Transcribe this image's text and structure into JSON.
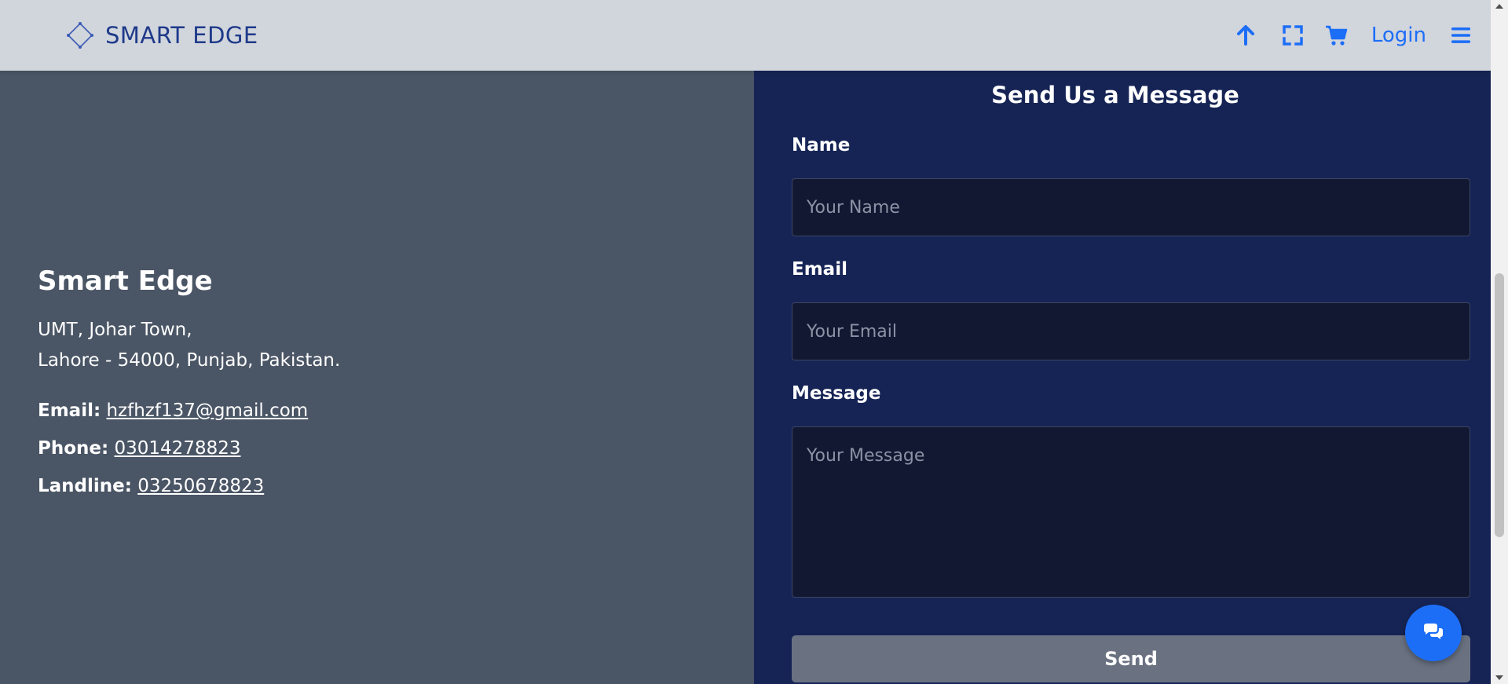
{
  "header": {
    "brand_name": "SMART EDGE",
    "logo_icon": "diamond-logo-icon",
    "actions": {
      "scroll_top_icon": "arrow-up-icon",
      "fullscreen_icon": "fullscreen-icon",
      "cart_icon": "cart-icon",
      "login_label": "Login",
      "menu_icon": "hamburger-menu-icon"
    }
  },
  "contact_info": {
    "company_name": "Smart Edge",
    "address_line1": "UMT, Johar Town,",
    "address_line2": "Lahore - 54000, Punjab, Pakistan.",
    "email_label": "Email:",
    "email_value": "hzfhzf137@gmail.com",
    "phone_label": "Phone:",
    "phone_value": "03014278823",
    "landline_label": "Landline:",
    "landline_value": "03250678823"
  },
  "form": {
    "title": "Send Us a Message",
    "name_label": "Name",
    "name_placeholder": "Your Name",
    "email_label": "Email",
    "email_placeholder": "Your Email",
    "message_label": "Message",
    "message_placeholder": "Your Message",
    "send_label": "Send"
  },
  "chat": {
    "icon": "chat-bubbles-icon"
  },
  "colors": {
    "navbar_bg": "#d1d5dc",
    "accent": "#1d6ef7",
    "brand_text": "#1e3a8a",
    "left_panel_bg": "#4a5565",
    "right_panel_bg": "#162455",
    "input_bg": "#121831",
    "send_button_bg": "#6a7282"
  }
}
